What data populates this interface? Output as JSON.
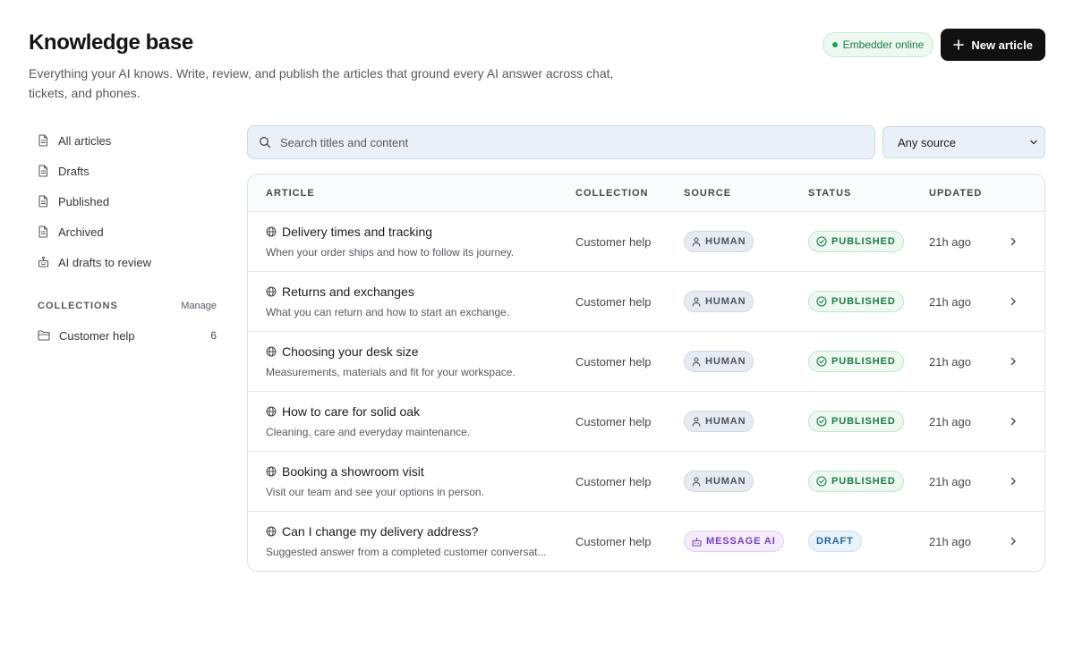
{
  "header": {
    "title": "Knowledge base",
    "subtitle": "Everything your AI knows. Write, review, and publish the articles that ground every AI answer across chat, tickets, and phones.",
    "status_label": "Embedder online",
    "new_article_label": "New article"
  },
  "sidebar": {
    "items": [
      {
        "label": "All articles",
        "icon": "document-icon"
      },
      {
        "label": "Drafts",
        "icon": "document-icon"
      },
      {
        "label": "Published",
        "icon": "document-icon"
      },
      {
        "label": "Archived",
        "icon": "document-icon"
      },
      {
        "label": "AI drafts to review",
        "icon": "bot-icon"
      }
    ],
    "collections_title": "COLLECTIONS",
    "manage_label": "Manage",
    "collections": [
      {
        "label": "Customer help",
        "count": "6",
        "icon": "folder-icon"
      }
    ]
  },
  "search": {
    "placeholder": "Search titles and content",
    "value": ""
  },
  "source_filter": {
    "selected": "Any source"
  },
  "table": {
    "columns": [
      "ARTICLE",
      "COLLECTION",
      "SOURCE",
      "STATUS",
      "UPDATED"
    ],
    "rows": [
      {
        "title": "Delivery times and tracking",
        "description": "When your order ships and how to follow its journey.",
        "collection": "Customer help",
        "source": "HUMAN",
        "status": "PUBLISHED",
        "updated": "21h ago"
      },
      {
        "title": "Returns and exchanges",
        "description": "What you can return and how to start an exchange.",
        "collection": "Customer help",
        "source": "HUMAN",
        "status": "PUBLISHED",
        "updated": "21h ago"
      },
      {
        "title": "Choosing your desk size",
        "description": "Measurements, materials and fit for your workspace.",
        "collection": "Customer help",
        "source": "HUMAN",
        "status": "PUBLISHED",
        "updated": "21h ago"
      },
      {
        "title": "How to care for solid oak",
        "description": "Cleaning, care and everyday maintenance.",
        "collection": "Customer help",
        "source": "HUMAN",
        "status": "PUBLISHED",
        "updated": "21h ago"
      },
      {
        "title": "Booking a showroom visit",
        "description": "Visit our team and see your options in person.",
        "collection": "Customer help",
        "source": "HUMAN",
        "status": "PUBLISHED",
        "updated": "21h ago"
      },
      {
        "title": "Can I change my delivery address?",
        "description": "Suggested answer from a completed customer conversat...",
        "collection": "Customer help",
        "source": "MESSAGE AI",
        "status": "DRAFT",
        "updated": "21h ago"
      }
    ]
  },
  "colors": {
    "primary_button": "#111111",
    "online_green": "#22a35a",
    "published_green": "#1f7a44",
    "draft_blue": "#26659a",
    "ai_purple": "#7a3fc0"
  }
}
